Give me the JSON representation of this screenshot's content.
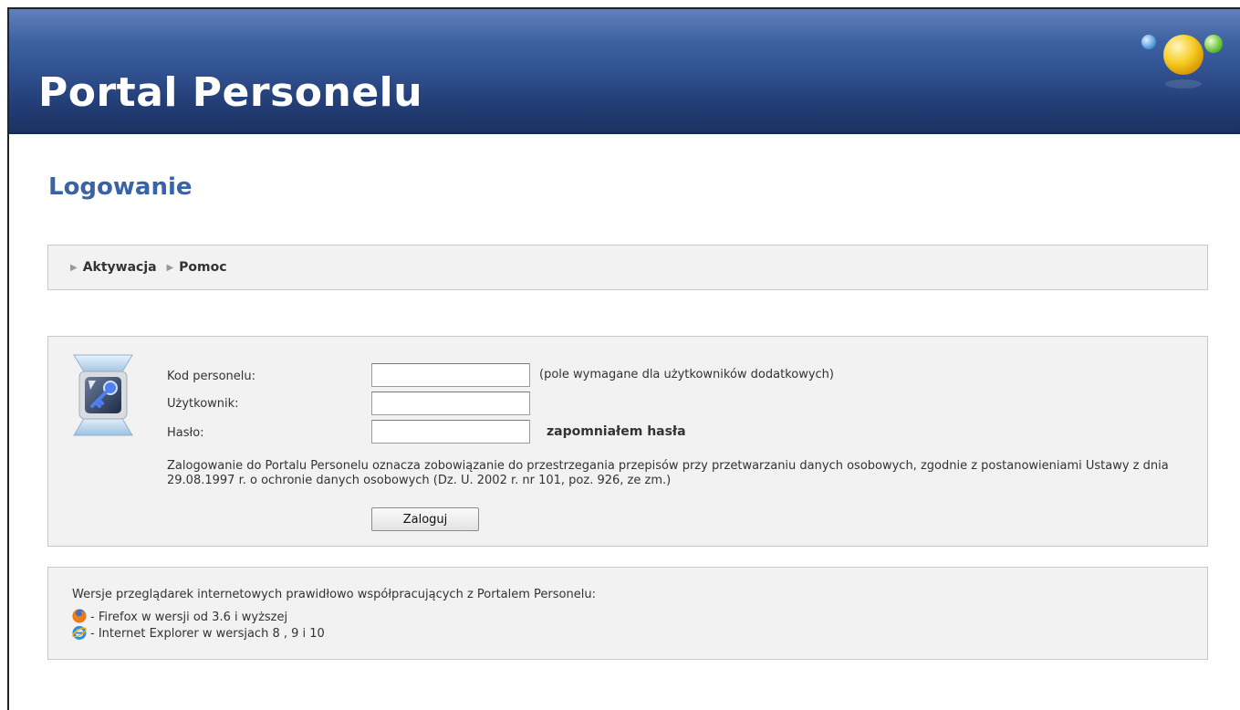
{
  "header": {
    "app_title": "Portal Personelu"
  },
  "page": {
    "title": "Logowanie"
  },
  "nav": {
    "items": [
      {
        "label": "Aktywacja"
      },
      {
        "label": "Pomoc"
      }
    ]
  },
  "login": {
    "staff_code_label": "Kod personelu:",
    "staff_code_value": "",
    "staff_code_hint": "(pole wymagane dla użytkowników dodatkowych)",
    "username_label": "Użytkownik:",
    "username_value": "",
    "password_label": "Hasło:",
    "password_value": "",
    "forgot_password": "zapomniałem hasła",
    "notice": "Zalogowanie do Portalu Personelu oznacza zobowiązanie do przestrzegania przepisów przy przetwarzaniu danych osobowych, zgodnie z postanowieniami Ustawy z dnia 29.08.1997 r. o ochronie danych osobowych (Dz. U. 2002 r. nr 101, poz. 926, ze zm.)",
    "submit_label": "Zaloguj"
  },
  "browsers": {
    "intro": "Wersje przeglądarek internetowych prawidłowo współpracujących z Portalem Personelu:",
    "items": [
      {
        "icon": "firefox-icon",
        "text": "- Firefox w wersji od 3.6 i wyższej"
      },
      {
        "icon": "internet-explorer-icon",
        "text": "- Internet Explorer w wersjach 8 , 9 i 10"
      }
    ]
  },
  "colors": {
    "header": "#2c4a86",
    "title": "#3a62a6",
    "panel": "#f2f2f2"
  }
}
